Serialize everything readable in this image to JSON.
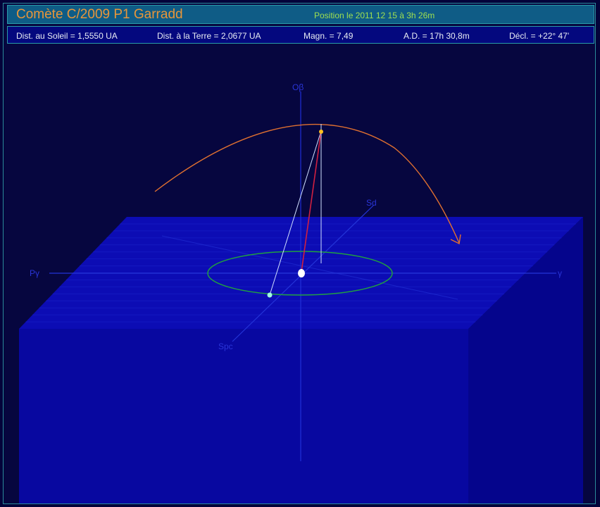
{
  "header": {
    "title": "Comète C/2009 P1 Garradd",
    "position": "Position le 2011 12 15 à 3h 26m"
  },
  "info": {
    "dist_sun": "Dist. au Soleil = 1,5550 UA",
    "dist_earth": "Dist. à la Terre = 2,0677 UA",
    "magnitude": "Magn. = 7,49",
    "ra": "A.D. = 17h 30,8m",
    "dec": "Décl. = +22° 47'"
  },
  "colors": {
    "title": "#e8963a",
    "position": "#9fe050",
    "comet_orbit": "#e07030",
    "earth_orbit": "#20a040",
    "background": "#06063f",
    "ecliptic_plane": "#0a0aa8"
  }
}
